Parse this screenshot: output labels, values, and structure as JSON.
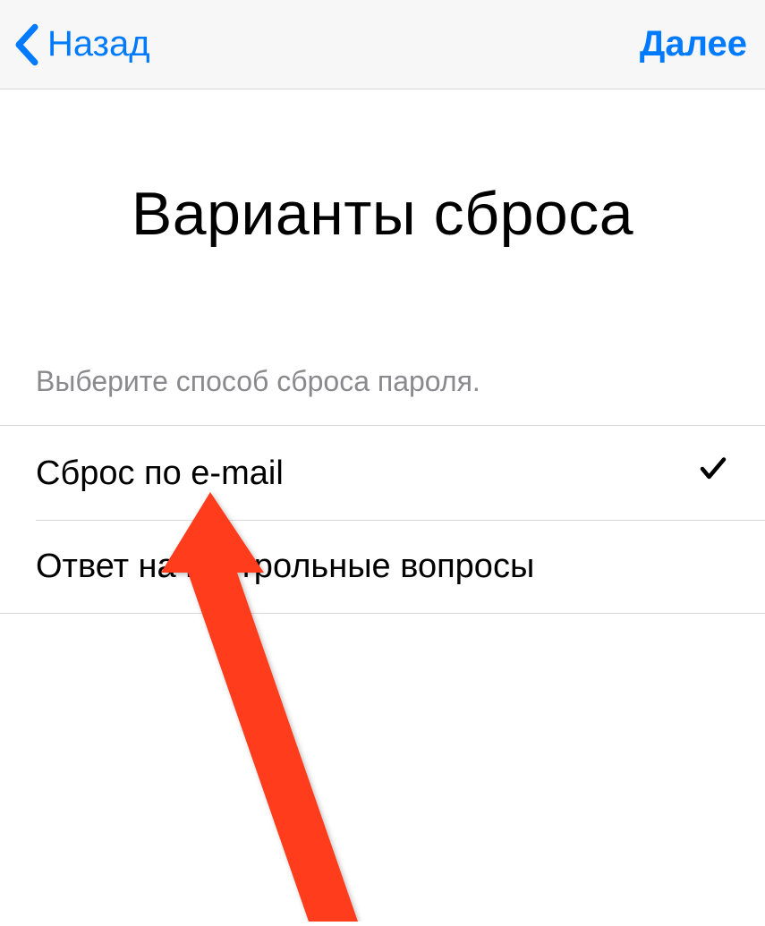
{
  "nav": {
    "back_label": "Назад",
    "next_label": "Далее"
  },
  "title": "Варианты сброса",
  "section_label": "Выберите способ сброса пароля.",
  "options": [
    {
      "label": "Сброс по e-mail",
      "selected": true
    },
    {
      "label": "Ответ на контрольные вопросы",
      "selected": false
    }
  ]
}
